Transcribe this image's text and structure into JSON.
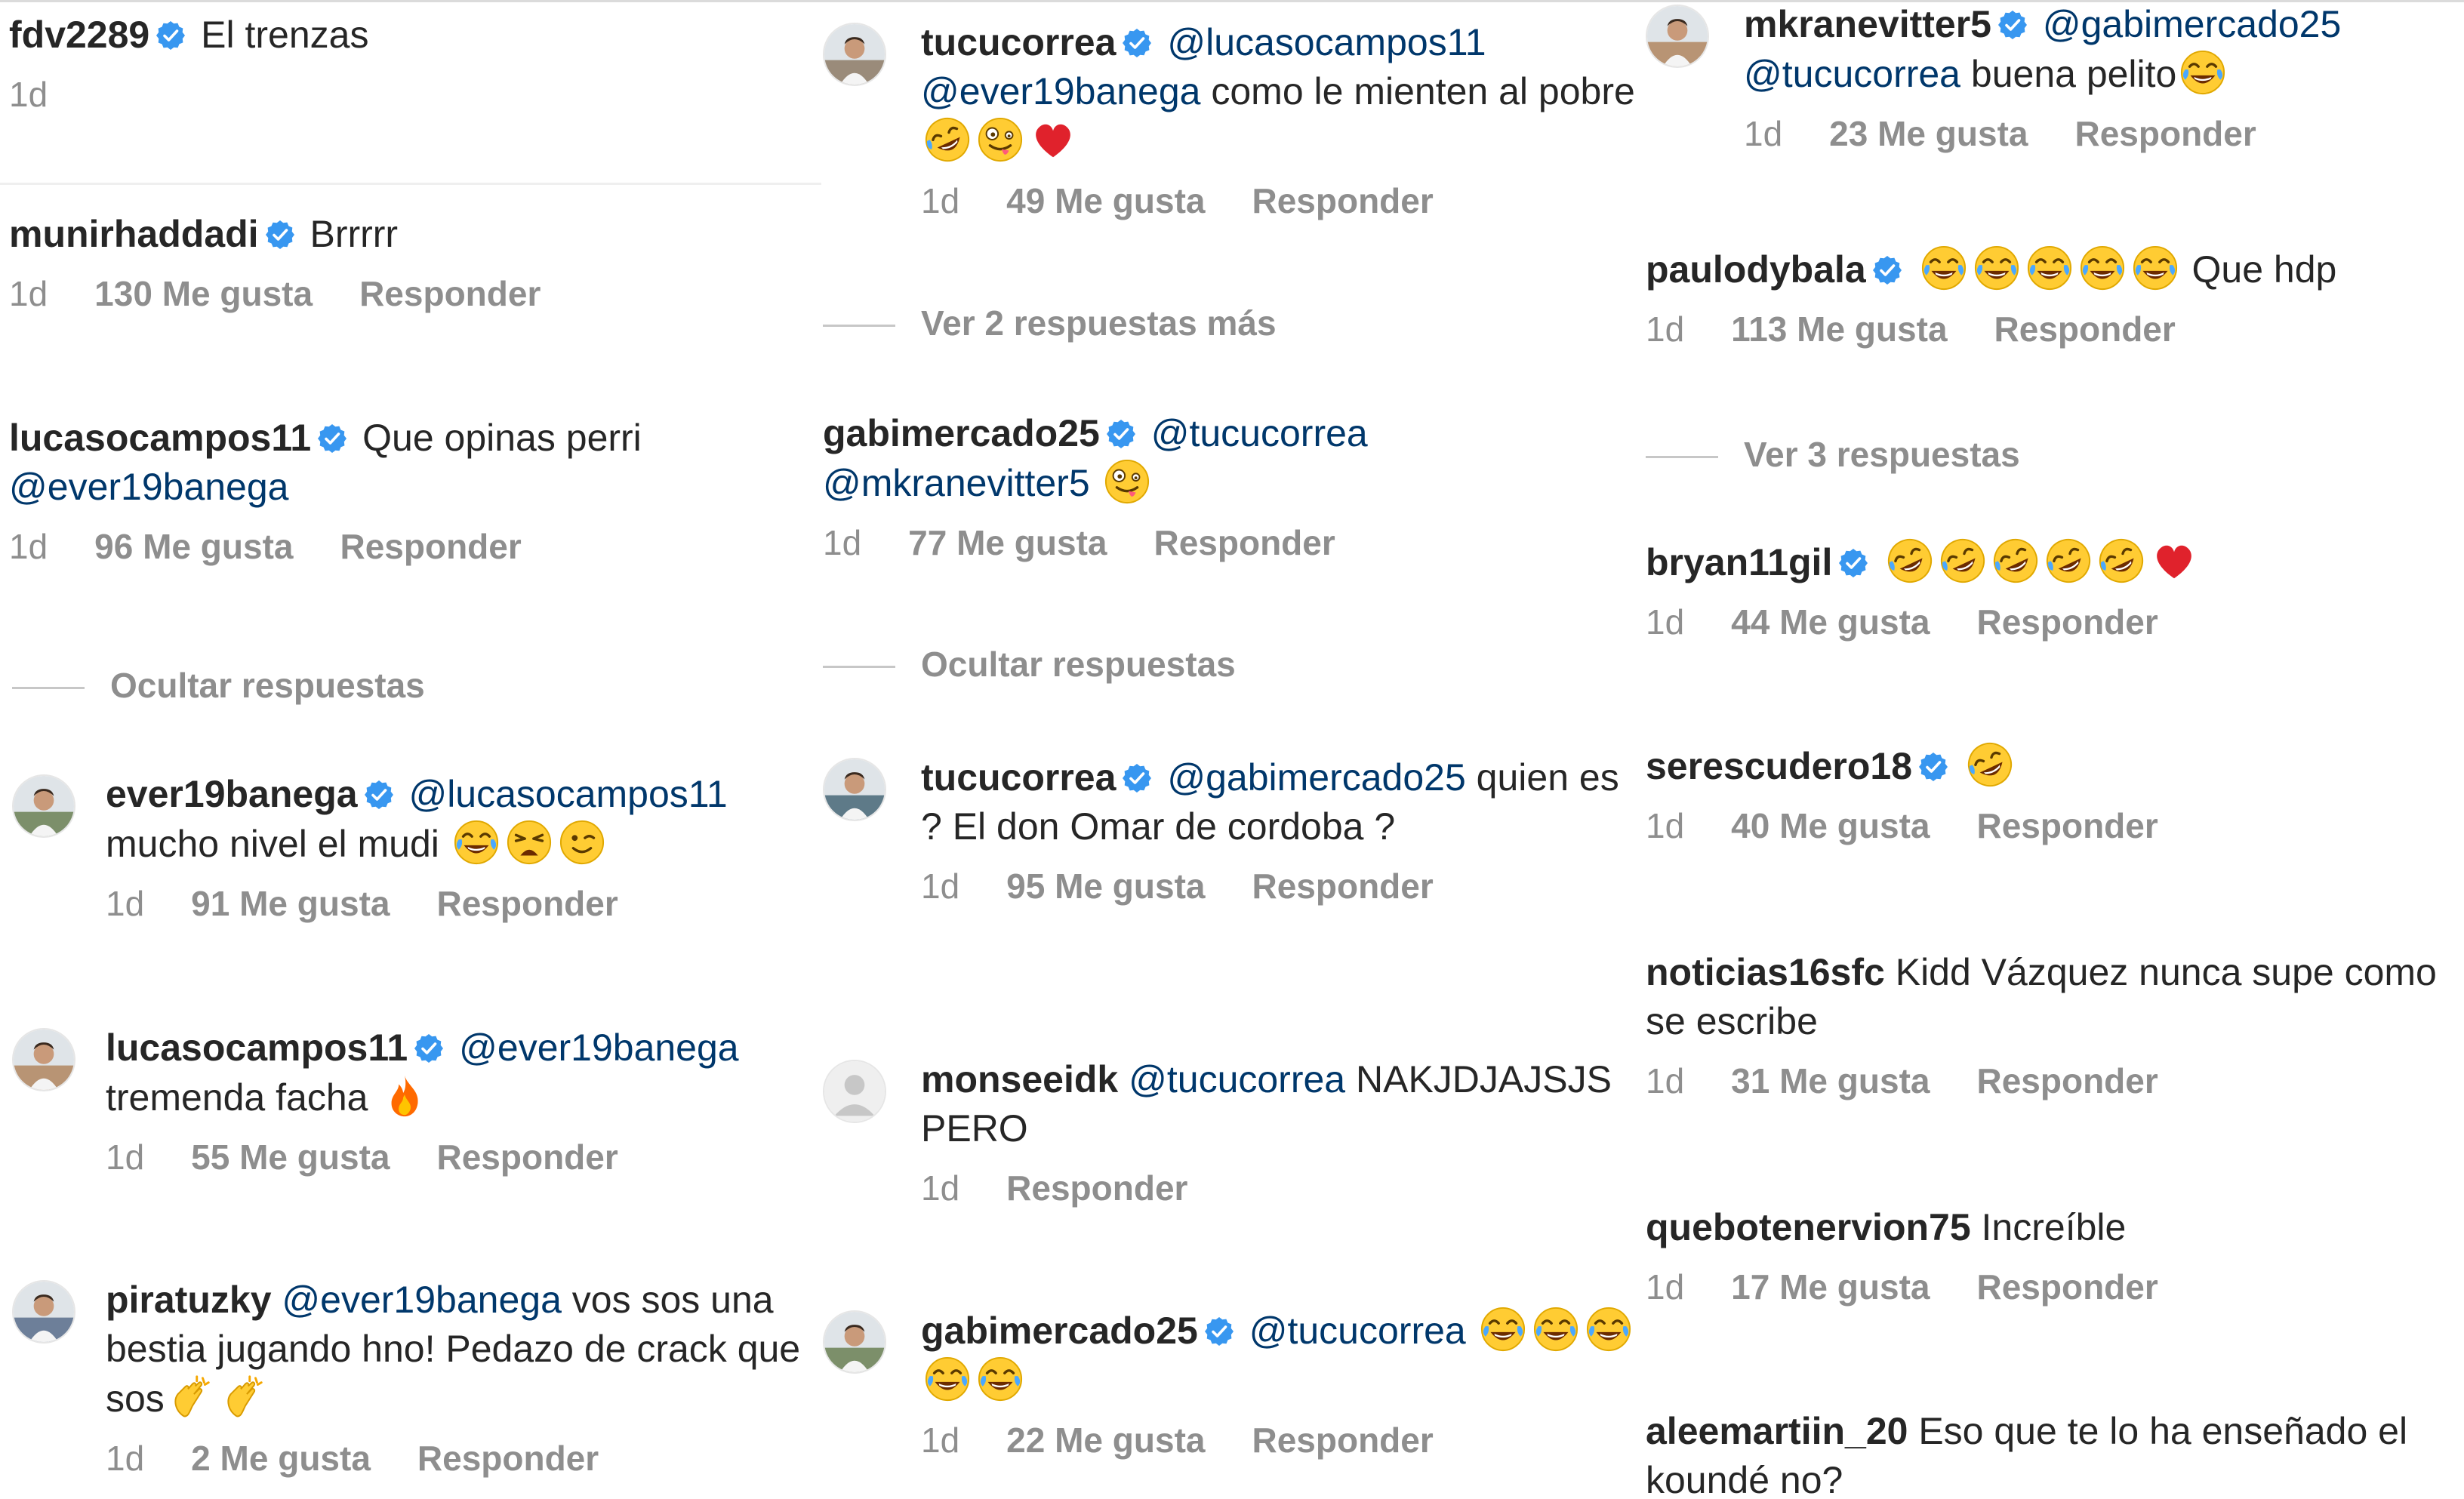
{
  "labels": {
    "likes_suffix": "Me gusta",
    "reply": "Responder"
  },
  "col1": [
    {
      "user": "fdv2289",
      "verified": true,
      "parts": [
        {
          "t": "text",
          "v": " El trenzas"
        }
      ],
      "time": "1d",
      "likes": null,
      "reply": false
    },
    {
      "user": "munirhaddadi",
      "verified": true,
      "parts": [
        {
          "t": "text",
          "v": " Brrrrr"
        }
      ],
      "time": "1d",
      "likes": "130 Me gusta",
      "reply": true
    },
    {
      "user": "lucasocampos11",
      "verified": true,
      "parts": [
        {
          "t": "text",
          "v": " Que opinas perri "
        },
        {
          "t": "mention",
          "v": "@ever19banega"
        }
      ],
      "time": "1d",
      "likes": "96 Me gusta",
      "reply": true
    },
    {
      "toggle": "Ocultar respuestas"
    },
    {
      "user": "ever19banega",
      "verified": true,
      "avatar": true,
      "parts": [
        {
          "t": "mention",
          "v": " @lucasocampos11"
        },
        {
          "t": "text",
          "v": " mucho nivel el mudi "
        },
        {
          "t": "emoji",
          "v": "joy"
        },
        {
          "t": "emoji",
          "v": "weary"
        },
        {
          "t": "emoji",
          "v": "wink"
        }
      ],
      "time": "1d",
      "likes": "91 Me gusta",
      "reply": true
    },
    {
      "user": "lucasocampos11",
      "verified": true,
      "avatar": true,
      "parts": [
        {
          "t": "mention",
          "v": " @ever19banega"
        },
        {
          "t": "text",
          "v": " tremenda facha "
        },
        {
          "t": "emoji",
          "v": "fire"
        }
      ],
      "time": "1d",
      "likes": "55 Me gusta",
      "reply": true
    },
    {
      "user": "piratuzky",
      "verified": false,
      "avatar": true,
      "parts": [
        {
          "t": "mention",
          "v": " @ever19banega"
        },
        {
          "t": "text",
          "v": " vos sos una bestia jugando hno! Pedazo de crack que sos"
        },
        {
          "t": "emoji",
          "v": "clap"
        },
        {
          "t": "emoji",
          "v": "clap"
        }
      ],
      "time": "1d",
      "likes": "2 Me gusta",
      "reply": true
    }
  ],
  "col2": [
    {
      "user": "tucucorrea",
      "verified": true,
      "avatar": true,
      "parts": [
        {
          "t": "mention",
          "v": " @lucasocampos11 @ever19banega"
        },
        {
          "t": "text",
          "v": "  como le mienten al pobre "
        },
        {
          "t": "emoji",
          "v": "rofl"
        },
        {
          "t": "emoji",
          "v": "zany"
        },
        {
          "t": "emoji",
          "v": "heart"
        }
      ],
      "time": "1d",
      "likes": "49 Me gusta",
      "reply": true
    },
    {
      "toggle": "Ver 2 respuestas más"
    },
    {
      "user": "gabimercado25",
      "verified": true,
      "parts": [
        {
          "t": "mention",
          "v": " @tucucorrea @mkranevitter5"
        },
        {
          "t": "text",
          "v": " "
        },
        {
          "t": "emoji",
          "v": "zany"
        }
      ],
      "time": "1d",
      "likes": "77 Me gusta",
      "reply": true
    },
    {
      "toggle": "Ocultar respuestas"
    },
    {
      "user": "tucucorrea",
      "verified": true,
      "avatar": true,
      "parts": [
        {
          "t": "mention",
          "v": " @gabimercado25"
        },
        {
          "t": "text",
          "v": " quien es ? El don Omar de cordoba ?"
        }
      ],
      "time": "1d",
      "likes": "95 Me gusta",
      "reply": true
    },
    {
      "user": "monseeidk",
      "verified": false,
      "avatar": true,
      "avatarEmpty": true,
      "parts": [
        {
          "t": "mention",
          "v": " @tucucorrea"
        },
        {
          "t": "text",
          "v": " NAKJDJAJSJS PERO"
        }
      ],
      "time": "1d",
      "likes": null,
      "reply": true
    },
    {
      "user": "gabimercado25",
      "verified": true,
      "avatar": true,
      "parts": [
        {
          "t": "mention",
          "v": " @tucucorrea"
        },
        {
          "t": "text",
          "v": " "
        },
        {
          "t": "emoji",
          "v": "joy"
        },
        {
          "t": "emoji",
          "v": "joy"
        },
        {
          "t": "emoji",
          "v": "joy"
        },
        {
          "t": "emoji",
          "v": "joy"
        },
        {
          "t": "emoji",
          "v": "joy"
        }
      ],
      "time": "1d",
      "likes": "22 Me gusta",
      "reply": true
    }
  ],
  "col3": [
    {
      "user": "mkranevitter5",
      "verified": true,
      "avatar": true,
      "parts": [
        {
          "t": "mention",
          "v": " @gabimercado25 @tucucorrea"
        },
        {
          "t": "text",
          "v": " buena pelito"
        },
        {
          "t": "emoji",
          "v": "joy"
        }
      ],
      "time": "1d",
      "likes": "23 Me gusta",
      "reply": true
    },
    {
      "user": "paulodybala",
      "verified": true,
      "parts": [
        {
          "t": "text",
          "v": " "
        },
        {
          "t": "emoji",
          "v": "joy"
        },
        {
          "t": "emoji",
          "v": "joy"
        },
        {
          "t": "emoji",
          "v": "joy"
        },
        {
          "t": "emoji",
          "v": "joy"
        },
        {
          "t": "emoji",
          "v": "joy"
        },
        {
          "t": "text",
          "v": " Que hdp"
        }
      ],
      "time": "1d",
      "likes": "113 Me gusta",
      "reply": true
    },
    {
      "toggle": "Ver 3 respuestas"
    },
    {
      "user": "bryan11gil",
      "verified": true,
      "parts": [
        {
          "t": "text",
          "v": " "
        },
        {
          "t": "emoji",
          "v": "rofl"
        },
        {
          "t": "emoji",
          "v": "rofl"
        },
        {
          "t": "emoji",
          "v": "rofl"
        },
        {
          "t": "emoji",
          "v": "rofl"
        },
        {
          "t": "emoji",
          "v": "rofl"
        },
        {
          "t": "emoji",
          "v": "heart"
        }
      ],
      "time": "1d",
      "likes": "44 Me gusta",
      "reply": true
    },
    {
      "user": "serescudero18",
      "verified": true,
      "parts": [
        {
          "t": "text",
          "v": " "
        },
        {
          "t": "emoji",
          "v": "rofl"
        }
      ],
      "time": "1d",
      "likes": "40 Me gusta",
      "reply": true
    },
    {
      "user": "noticias16sfc",
      "verified": false,
      "parts": [
        {
          "t": "text",
          "v": " Kidd Vázquez nunca supe como se escribe"
        }
      ],
      "time": "1d",
      "likes": "31 Me gusta",
      "reply": true
    },
    {
      "user": "quebotenervion75",
      "verified": false,
      "parts": [
        {
          "t": "text",
          "v": " Increíble"
        }
      ],
      "time": "1d",
      "likes": "17 Me gusta",
      "reply": true
    },
    {
      "user": "aleemartiin_20",
      "verified": false,
      "parts": [
        {
          "t": "text",
          "v": " Eso que te lo ha enseñado el koundé no?"
        }
      ],
      "time": null,
      "likes": null,
      "reply": false
    }
  ],
  "colors": {
    "text": "#262626",
    "mention": "#00376b",
    "meta": "#8e8e8e",
    "verified": "#3897f0"
  }
}
